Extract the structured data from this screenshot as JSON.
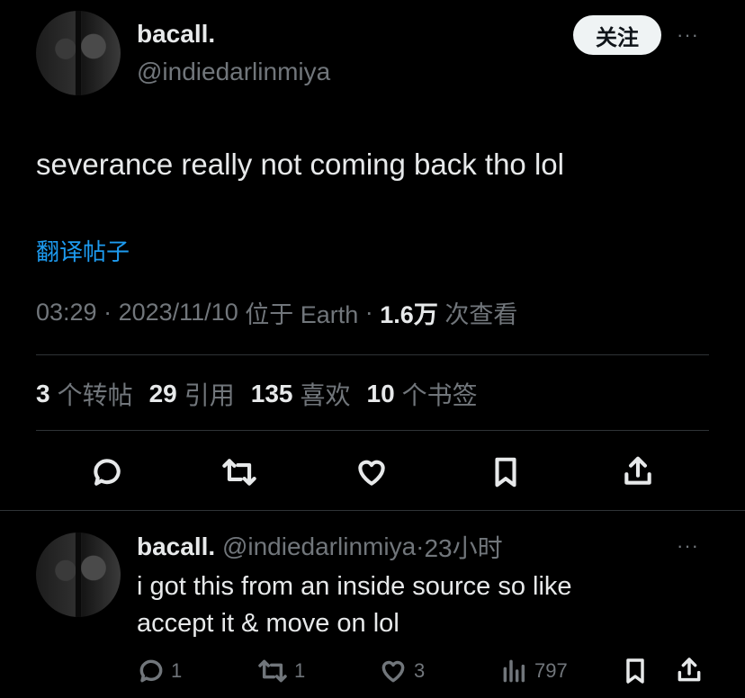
{
  "tweet": {
    "author_name": "bacall.",
    "author_handle": "@indiedarlinmiya",
    "follow_label": "关注",
    "more_label": "···",
    "text": "severance really not coming back tho lol",
    "translate_label": "翻译帖子",
    "meta": {
      "time": "03:29",
      "sep1": " · ",
      "date": "2023/11/10",
      "location": "位于 Earth",
      "sep2": " · ",
      "views": "1.6万",
      "views_label": "次查看"
    },
    "stats": [
      {
        "count": "3",
        "label": "个转帖"
      },
      {
        "count": "29",
        "label": "引用"
      },
      {
        "count": "135",
        "label": "喜欢"
      },
      {
        "count": "10",
        "label": "个书签"
      }
    ],
    "actions": [
      "reply-icon",
      "retweet-icon",
      "like-icon",
      "bookmark-icon",
      "share-icon"
    ]
  },
  "reply": {
    "author_name": "bacall.",
    "author_handle": "@indiedarlinmiya",
    "sep": "·",
    "time": "23小时",
    "more_label": "···",
    "text_line1": "i got this from an inside source so like",
    "text_line2": "accept it & move on lol",
    "replies": "1",
    "retweets": "1",
    "likes": "3",
    "views": "797"
  },
  "colors": {
    "background": "#000000",
    "text": "#e7e9ea",
    "muted": "#71767b",
    "link": "#1d9bf0",
    "divider": "#2f3336"
  }
}
